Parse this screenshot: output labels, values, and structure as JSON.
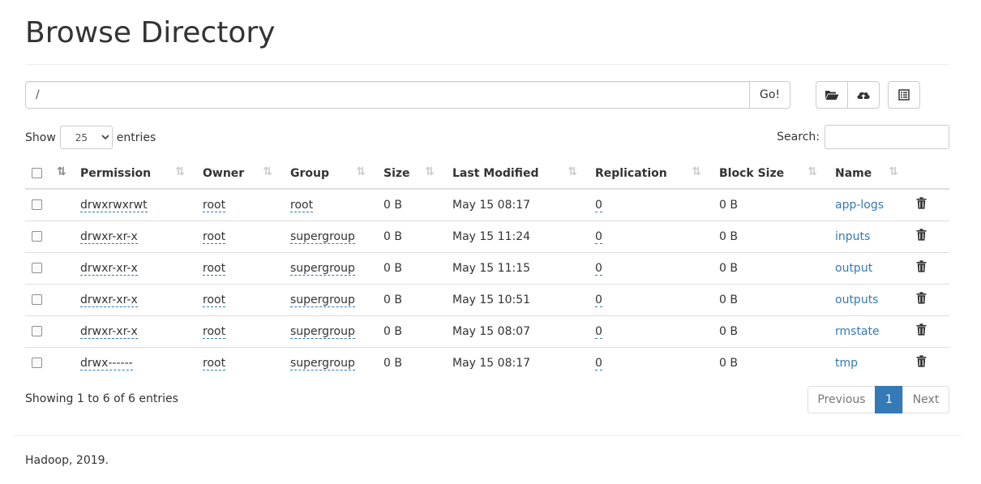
{
  "page": {
    "title": "Browse Directory"
  },
  "path_bar": {
    "value": "/",
    "go_label": "Go!"
  },
  "toolbar": {
    "icons": [
      "folder-open-icon",
      "cloud-upload-icon",
      "list-alt-icon"
    ]
  },
  "length": {
    "show_label": "Show",
    "selected": "25",
    "entries_label": "entries",
    "options": [
      "25"
    ]
  },
  "search": {
    "label": "Search:",
    "value": ""
  },
  "table": {
    "columns": [
      "Permission",
      "Owner",
      "Group",
      "Size",
      "Last Modified",
      "Replication",
      "Block Size",
      "Name"
    ],
    "rows": [
      {
        "permission": "drwxrwxrwt",
        "owner": "root",
        "group": "root",
        "size": "0 B",
        "modified": "May 15 08:17",
        "replication": "0",
        "block_size": "0 B",
        "name": "app-logs"
      },
      {
        "permission": "drwxr-xr-x",
        "owner": "root",
        "group": "supergroup",
        "size": "0 B",
        "modified": "May 15 11:24",
        "replication": "0",
        "block_size": "0 B",
        "name": "inputs"
      },
      {
        "permission": "drwxr-xr-x",
        "owner": "root",
        "group": "supergroup",
        "size": "0 B",
        "modified": "May 15 11:15",
        "replication": "0",
        "block_size": "0 B",
        "name": "output"
      },
      {
        "permission": "drwxr-xr-x",
        "owner": "root",
        "group": "supergroup",
        "size": "0 B",
        "modified": "May 15 10:51",
        "replication": "0",
        "block_size": "0 B",
        "name": "outputs"
      },
      {
        "permission": "drwxr-xr-x",
        "owner": "root",
        "group": "supergroup",
        "size": "0 B",
        "modified": "May 15 08:07",
        "replication": "0",
        "block_size": "0 B",
        "name": "rmstate"
      },
      {
        "permission": "drwx------",
        "owner": "root",
        "group": "supergroup",
        "size": "0 B",
        "modified": "May 15 08:17",
        "replication": "0",
        "block_size": "0 B",
        "name": "tmp"
      }
    ]
  },
  "info": {
    "text": "Showing 1 to 6 of 6 entries"
  },
  "pagination": {
    "previous": "Previous",
    "current": "1",
    "next": "Next"
  },
  "footer": {
    "text": "Hadoop, 2019."
  },
  "colors": {
    "link": "#337ab7",
    "active_page": "#337ab7"
  }
}
